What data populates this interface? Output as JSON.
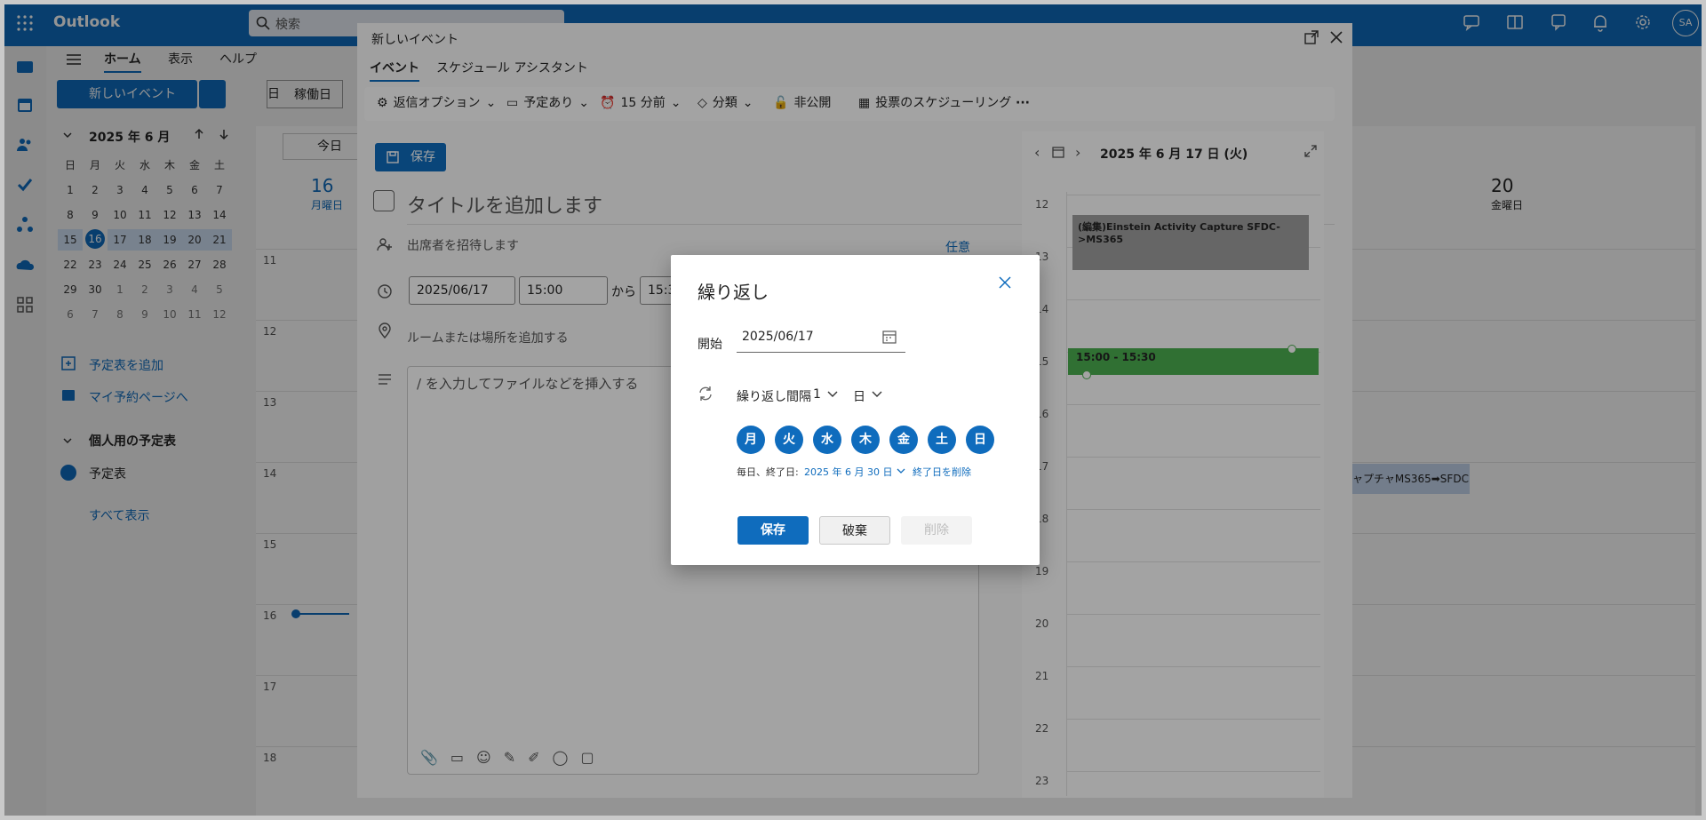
{
  "app": {
    "name": "Outlook",
    "search_placeholder": "検索",
    "avatar_initials": "SA"
  },
  "ribbon": {
    "tabs": [
      "ホーム",
      "表示",
      "ヘルプ"
    ],
    "new_event_label": "新しいイベント",
    "day_label": "日",
    "workweek_label": "稼働日"
  },
  "mini_calendar": {
    "title": "2025 年 6 月",
    "weekdays": [
      "日",
      "月",
      "火",
      "水",
      "木",
      "金",
      "土"
    ],
    "weeks": [
      [
        "1",
        "2",
        "3",
        "4",
        "5",
        "6",
        "7"
      ],
      [
        "8",
        "9",
        "10",
        "11",
        "12",
        "13",
        "14"
      ],
      [
        "15",
        "16",
        "17",
        "18",
        "19",
        "20",
        "21"
      ],
      [
        "22",
        "23",
        "24",
        "25",
        "26",
        "27",
        "28"
      ],
      [
        "29",
        "30",
        "1",
        "2",
        "3",
        "4",
        "5"
      ],
      [
        "6",
        "7",
        "8",
        "9",
        "10",
        "11",
        "12"
      ]
    ],
    "today": "16"
  },
  "sidebar": {
    "add_calendar": "予定表を追加",
    "booking_page": "マイ予約ページへ",
    "personal_calendars": "個人用の予定表",
    "calendar_item": "予定表",
    "show_all": "すべて表示"
  },
  "calendar_view": {
    "today_button": "今日",
    "day16_num": "16",
    "day16_name": "月曜日",
    "day20_num": "20",
    "day20_name": "金曜日",
    "hours": [
      "11",
      "12",
      "13",
      "14",
      "15",
      "16",
      "17",
      "18"
    ],
    "event_text": "ャプチャMS365➡SFDC フ"
  },
  "editor": {
    "window_title": "新しいイベント",
    "tabs": [
      "イベント",
      "スケジュール アシスタント"
    ],
    "toolbar": {
      "response_options": "返信オプション",
      "busy": "予定あり",
      "reminder": "15 分前",
      "categorize": "分類",
      "private": "非公開",
      "scheduling_poll": "投票のスケジューリング",
      "more": "···"
    },
    "save_label": "保存",
    "title_placeholder": "タイトルを追加します",
    "attendees_placeholder": "出席者を招待します",
    "optional_label": "任意",
    "start_date": "2025/06/17",
    "start_time": "15:00",
    "from_label": "から",
    "end_time": "15:3",
    "location_placeholder": "ルームまたは場所を追加する",
    "body_placeholder": "/ を入力してファイルなどを挿入する"
  },
  "day_panel": {
    "date_label": "2025 年 6 月 17 日 (火)",
    "hours": [
      "12",
      "13",
      "14",
      "15",
      "16",
      "17",
      "18",
      "19",
      "20",
      "21",
      "22",
      "23"
    ],
    "events": [
      {
        "title": "(編集)Einstein Activity Capture SFDC->MS365",
        "color": "#a0a0a0"
      },
      {
        "title": "15:00 - 15:30",
        "color": "#4caf50"
      }
    ]
  },
  "dialog": {
    "title": "繰り返し",
    "start_label": "開始",
    "start_value": "2025/06/17",
    "interval_label": "繰り返し間隔",
    "interval_value": "1",
    "interval_unit": "日",
    "days": [
      "月",
      "火",
      "水",
      "木",
      "金",
      "土",
      "日"
    ],
    "summary_prefix": "毎日、終了日:",
    "end_date": "2025 年 6 月 30 日",
    "remove_end": "終了日を削除",
    "save": "保存",
    "discard": "破棄",
    "delete": "削除"
  },
  "colors": {
    "brand": "#0f6cbd",
    "green_event": "#4caf50",
    "gray_event": "#a0a0a0"
  }
}
